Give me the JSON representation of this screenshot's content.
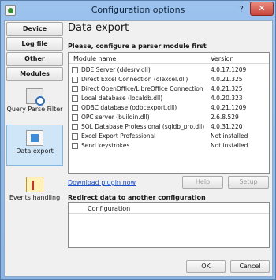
{
  "window": {
    "title": "Configuration options",
    "help_glyph": "?",
    "close_glyph": "✕"
  },
  "sidebar": {
    "tabs": [
      "Device",
      "Log file",
      "Other",
      "Modules"
    ],
    "items": [
      {
        "label": "Query Parse Filter",
        "icon": "query-parse-filter-icon"
      },
      {
        "label": "Data export",
        "icon": "data-export-icon"
      },
      {
        "label": "Events handling",
        "icon": "events-handling-icon"
      }
    ],
    "active_item": "Data export"
  },
  "main": {
    "title": "Data export",
    "section1_title": "Please, configure a parser module first",
    "columns": {
      "name": "Module name",
      "version": "Version"
    },
    "rows": [
      {
        "name": "DDE Server (ddesrv.dll)",
        "version": "4.0.17.1209"
      },
      {
        "name": "Direct Excel Connection (olexcel.dll)",
        "version": "4.0.21.325"
      },
      {
        "name": "Direct OpenOffice/LibreOffice Connection",
        "version": "4.0.21.325"
      },
      {
        "name": "Local database (localdb.dll)",
        "version": "4.0.20.323"
      },
      {
        "name": "ODBC database (odbcexport.dll)",
        "version": "4.0.21.1209"
      },
      {
        "name": "OPC server (buildin.dll)",
        "version": "2.6.8.529"
      },
      {
        "name": "SQL Database Professional (sqldb_pro.dll)",
        "version": "4.0.31.220"
      },
      {
        "name": "Excel Export Professional",
        "version": "Not installed"
      },
      {
        "name": "Send keystrokes",
        "version": "Not installed"
      }
    ],
    "download_link": "Download plugin now",
    "help_button": "Help",
    "setup_button": "Setup",
    "section2_title": "Redirect data to another configuration",
    "config_column": "Configuration"
  },
  "footer": {
    "ok": "OK",
    "cancel": "Cancel"
  },
  "colors": {
    "title_bar": "#8fb8e8",
    "active_sidebar": "#cfe5f8",
    "link": "#1a4ec9",
    "close_button": "#c8453a"
  }
}
